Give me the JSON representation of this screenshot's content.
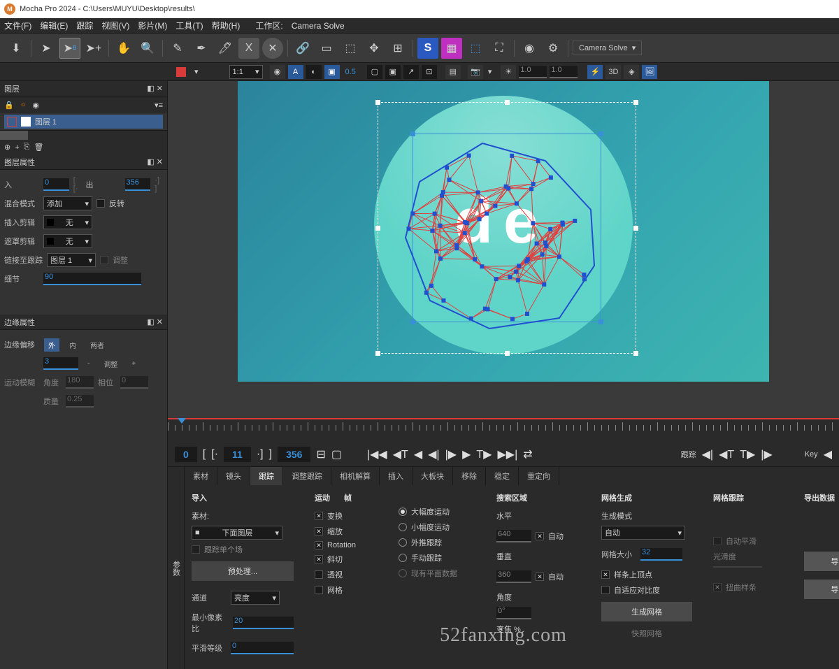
{
  "title": "Mocha Pro 2024 - C:\\Users\\MUYU\\Desktop\\results\\",
  "app_icon": "M",
  "menu": [
    "文件(F)",
    "编辑(E)",
    "跟踪",
    "视图(V)",
    "影片(M)",
    "工具(T)",
    "帮助(H)"
  ],
  "workspace_label": "工作区:",
  "workspace_value": "Camera Solve",
  "solve_dropdown": "Camera Solve",
  "zoom": "1:1",
  "viewbar_num": "0.5",
  "viewbar_val1": "1.0",
  "viewbar_val2": "1.0",
  "viewbar_3d": "3D",
  "layers": {
    "title": "图层",
    "item": "图层 1"
  },
  "layer_props": {
    "title": "图层属性",
    "in_label": "入",
    "in_val": "0",
    "out_label": "出",
    "out_val": "356",
    "blend_label": "混合模式",
    "blend_val": "添加",
    "invert": "反转",
    "insert_label": "插入剪辑",
    "insert_val": "无",
    "matte_label": "遮罩剪辑",
    "matte_val": "无",
    "link_label": "链接至跟踪",
    "link_val": "图层 1",
    "adjust": "调整",
    "detail_label": "细节",
    "detail_val": "90"
  },
  "edge_props": {
    "title": "边缘属性",
    "offset_label": "边缘偏移",
    "outer": "外",
    "inner": "内",
    "both": "两者",
    "val": "3",
    "adjust": "调整",
    "motion_label": "运动模糊",
    "angle_label": "角度",
    "angle_val": "180",
    "phase_label": "相位",
    "phase_val": "0",
    "quality_label": "质量",
    "quality_val": "0.25"
  },
  "transport": {
    "start": "0",
    "in": "11",
    "out": "356",
    "track_label": "跟踪",
    "key_label": "Key"
  },
  "params": {
    "title": "参数",
    "tabs": [
      "素材",
      "镜头",
      "跟踪",
      "调整跟踪",
      "相机解算",
      "插入",
      "大板块",
      "移除",
      "稳定",
      "重定向"
    ],
    "import": {
      "head": "导入",
      "clip_label": "素材:",
      "clip_val": "下面图层",
      "single": "跟踪单个场",
      "preprocess": "预处理...",
      "channel_label": "通道",
      "channel_val": "亮度",
      "minpx_label": "最小像素比",
      "minpx_val": "20",
      "smooth_label": "平滑等级",
      "smooth_val": "0"
    },
    "motion": {
      "head1": "运动",
      "head2": "帧",
      "transform": "变换",
      "scale": "缩放",
      "rotation": "Rotation",
      "shear": "斜切",
      "perspective": "透视",
      "mesh": "网格",
      "large": "大幅度运动",
      "small": "小幅度运动",
      "extrap": "外推跟踪",
      "manual": "手动跟踪",
      "existing": "现有平面数据"
    },
    "search": {
      "head": "搜索区域",
      "horiz": "水平",
      "horiz_val": "640",
      "auto": "自动",
      "vert": "垂直",
      "vert_val": "360",
      "angle": "角度",
      "angle_val": "0°",
      "zoom": "变焦 %"
    },
    "meshgen": {
      "head": "网格生成",
      "mode_label": "生成模式",
      "mode_val": "自动",
      "size_label": "网格大小",
      "size_val": "32",
      "spline": "样条上顶点",
      "adaptive": "自适应对比度",
      "generate": "生成网格",
      "snapshot": "快照网格"
    },
    "meshtrack": {
      "head": "网格跟踪",
      "autosmooth": "自动平滑",
      "smoothness": "光滑度",
      "warpspline": "扭曲样条"
    },
    "export": {
      "head": "导出数据",
      "track": "导出跟踪...",
      "shape": "导出形状..."
    }
  },
  "watermark": "52fanxing.com"
}
